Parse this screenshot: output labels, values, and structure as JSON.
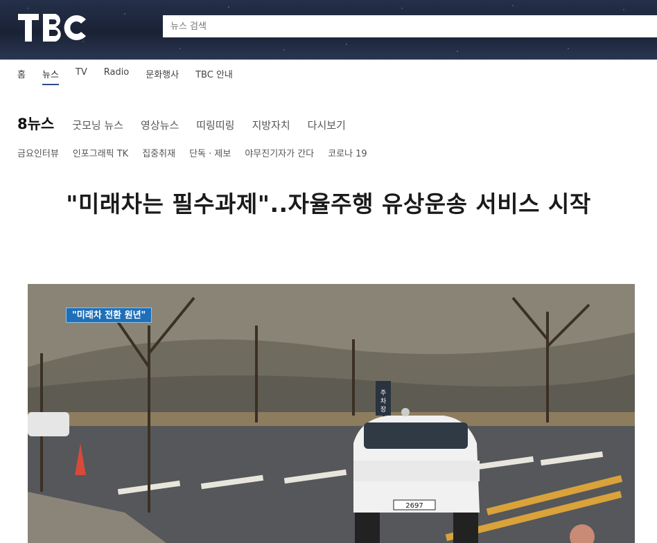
{
  "header": {
    "logo_text": "TBC",
    "search_placeholder": "뉴스 검색"
  },
  "nav": {
    "items": [
      "홈",
      "뉴스",
      "TV",
      "Radio",
      "문화행사",
      "TBC 안내"
    ],
    "active": "뉴스"
  },
  "category": {
    "main": "8뉴스",
    "items": [
      "굿모닝 뉴스",
      "영상뉴스",
      "띠링띠링",
      "지방자치",
      "다시보기"
    ]
  },
  "subcategory": {
    "items": [
      "금요인터뷰",
      "인포그래픽 TK",
      "집중취재",
      "단독 · 제보",
      "야무진기자가 간다",
      "코로나 19"
    ]
  },
  "article": {
    "headline": "\"미래차는 필수과제\"..자율주행 유상운송 서비스 시작"
  },
  "media": {
    "caption_tag": "\"미래차 전환 원년\"",
    "plate_text": "2697",
    "sign_text": "주차장"
  },
  "colors": {
    "header_bg": "#1c2538",
    "active_underline": "#2b4d88",
    "caption_bg": "#1f6fb8"
  }
}
